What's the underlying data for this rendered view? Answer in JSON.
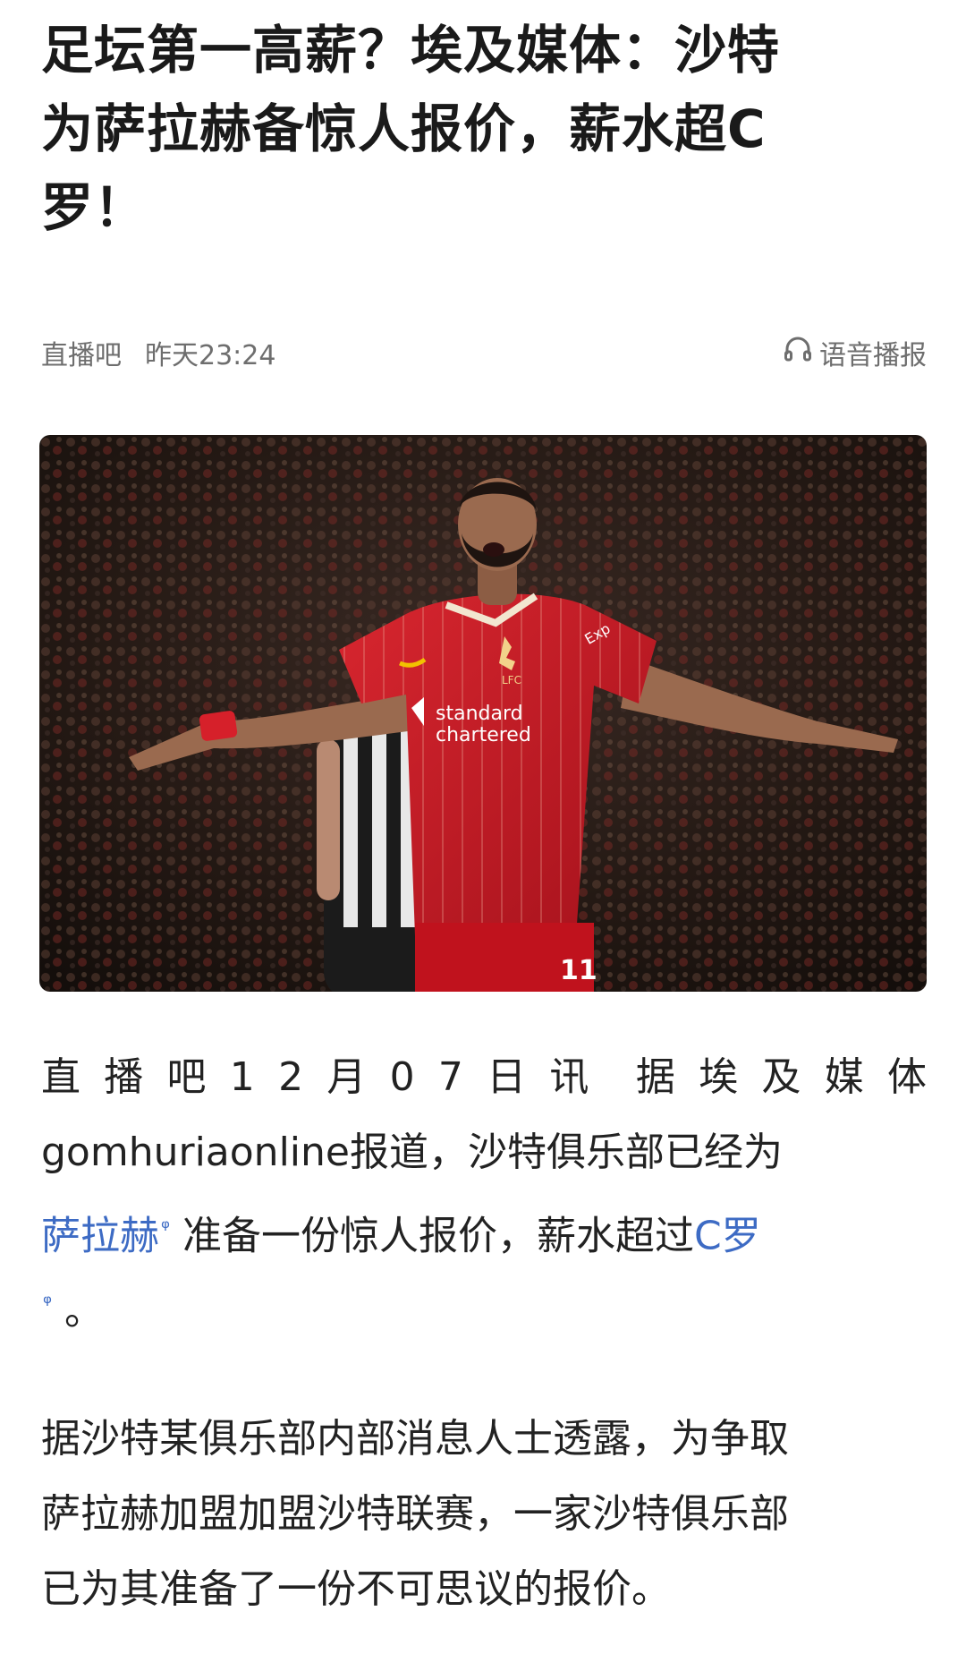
{
  "article": {
    "title_lines": [
      "足坛第一高薪？埃及媒体：沙特",
      "为萨拉赫备惊人报价，薪水超C",
      "罗！"
    ],
    "source": "直播吧",
    "time": "昨天23:24",
    "tts_label": "语音播报"
  },
  "hero_image": {
    "alt": "",
    "sponsor_line1": "standard",
    "sponsor_line2": "chartered",
    "shirt_number": "11",
    "crest_text": "LFC",
    "sleeve_text": "Exp"
  },
  "paragraph1": {
    "line1_chars": [
      "直",
      "播",
      "吧",
      "1",
      "2",
      "月",
      "0",
      "7",
      "日",
      "讯",
      "",
      "据",
      "埃",
      "及",
      "媒",
      "体"
    ],
    "line2": "gomhuriaonline报道，沙特俱乐部已经为",
    "link1": "萨拉赫",
    "line3_mid": " 准备一份惊人报价，薪水超过",
    "link2": "C罗",
    "search_icon": "ᵠ",
    "line4_end": "。"
  },
  "paragraph2": {
    "lines": [
      "据沙特某俱乐部内部消息人士透露，为争取",
      "萨拉赫加盟加盟沙特联赛，一家沙特俱乐部",
      "已为其准备了一份不可思议的报价。"
    ]
  },
  "colors": {
    "link": "#3d6bc4",
    "meta": "#6e6e6e",
    "jersey": "#c8102e"
  }
}
